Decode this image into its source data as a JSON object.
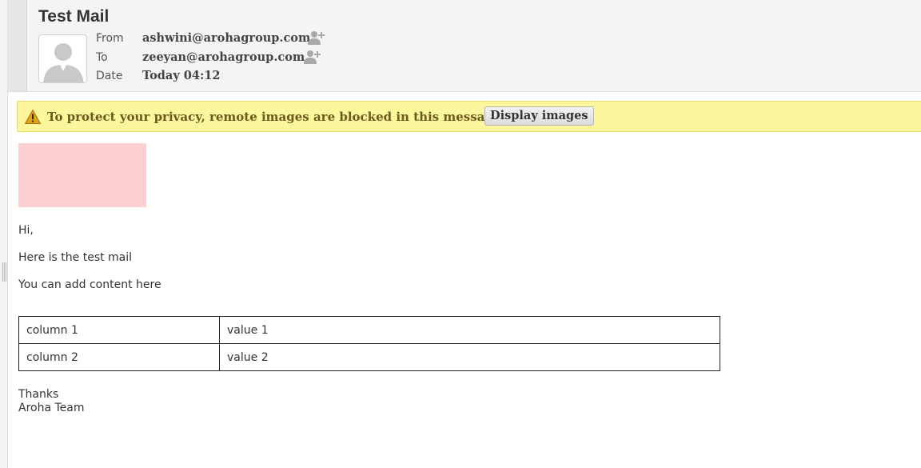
{
  "message": {
    "subject": "Test Mail",
    "from_label": "From",
    "from_value": "ashwini@arohagroup.com",
    "to_label": "To",
    "to_value": "zeeyan@arohagroup.com",
    "date_label": "Date",
    "date_value": "Today 04:12"
  },
  "icons": {
    "avatar": "default-user-avatar-icon",
    "add_contact": "add-contact-icon",
    "warning": "warning-triangle-icon"
  },
  "banner": {
    "text": "To protect your privacy, remote images are blocked in this message.",
    "button_label": "Display images"
  },
  "body": {
    "greeting": "Hi,",
    "line1": "Here is the test mail",
    "line2": "You can add content here",
    "table": [
      [
        "column 1",
        "value 1"
      ],
      [
        "column 2",
        "value 2"
      ]
    ],
    "signoff": "Thanks",
    "signature": "Aroha Team"
  },
  "colors": {
    "banner_bg": "#fcf69c",
    "banner_text": "#6b5a1d",
    "blocked_image_placeholder": "#fcd0d1",
    "header_bg": "#f4f4f4"
  }
}
